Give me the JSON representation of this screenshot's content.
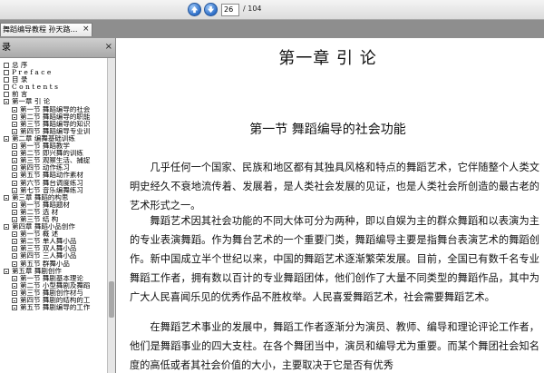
{
  "toolbar": {
    "page_current": "26",
    "page_total": "/ 104",
    "prev_icon": "arrow-up-icon",
    "next_icon": "arrow-down-icon"
  },
  "tab": {
    "title": "舞蹈编导教程 孙天路…",
    "close": "×"
  },
  "sidebar": {
    "header": "录",
    "close": "×",
    "items": [
      {
        "level": 1,
        "label": "总    序",
        "expand": false
      },
      {
        "level": 1,
        "label": "P r e f a c e",
        "expand": false
      },
      {
        "level": 1,
        "label": "目    录",
        "expand": false
      },
      {
        "level": 1,
        "label": "C o n t e n t s",
        "expand": false
      },
      {
        "level": 1,
        "label": "前    言",
        "expand": false
      },
      {
        "level": 1,
        "label": "第一章  引    论",
        "expand": true
      },
      {
        "level": 2,
        "label": "第一节   舞蹈编导的社会",
        "expand": false
      },
      {
        "level": 2,
        "label": "第二节   舞蹈编导的职能",
        "expand": false
      },
      {
        "level": 2,
        "label": "第三节   舞蹈编导的知识",
        "expand": false
      },
      {
        "level": 2,
        "label": "第四节   舞蹈编导专业训",
        "expand": false
      },
      {
        "level": 1,
        "label": "第二章  编舞基础训练",
        "expand": true
      },
      {
        "level": 2,
        "label": "第一节   舞蹈教学",
        "expand": false
      },
      {
        "level": 2,
        "label": "第二节   即兴舞的训练",
        "expand": false
      },
      {
        "level": 2,
        "label": "第三节   观察生活、捕捉",
        "expand": false
      },
      {
        "level": 2,
        "label": "第四节   动作练习",
        "expand": false
      },
      {
        "level": 2,
        "label": "第五节   舞蹈动作素材",
        "expand": false
      },
      {
        "level": 2,
        "label": "第六节   舞台调度练习",
        "expand": false
      },
      {
        "level": 2,
        "label": "第七节   音乐编舞练习",
        "expand": false
      },
      {
        "level": 1,
        "label": "第三章  舞蹈的构思",
        "expand": true
      },
      {
        "level": 2,
        "label": "第一节   舞蹈题材",
        "expand": false
      },
      {
        "level": 2,
        "label": "第二节   选      材",
        "expand": false
      },
      {
        "level": 2,
        "label": "第三节   结      构",
        "expand": false
      },
      {
        "level": 1,
        "label": "第四章  舞蹈小品创作",
        "expand": true
      },
      {
        "level": 2,
        "label": "第一节   概      述",
        "expand": false
      },
      {
        "level": 2,
        "label": "第二节   单人舞小品",
        "expand": false
      },
      {
        "level": 2,
        "label": "第三节   双人舞小品",
        "expand": false
      },
      {
        "level": 2,
        "label": "第四节   三人舞小品",
        "expand": false
      },
      {
        "level": 2,
        "label": "第五节   群舞小品",
        "expand": false
      },
      {
        "level": 1,
        "label": "第五章  舞剧创作",
        "expand": true
      },
      {
        "level": 2,
        "label": "第一节   舞剧基本理论",
        "expand": false
      },
      {
        "level": 2,
        "label": "第二节   小型舞剧及舞蹈",
        "expand": false
      },
      {
        "level": 2,
        "label": "第三节   舞剧创作材与",
        "expand": false
      },
      {
        "level": 2,
        "label": "第四节   舞剧的结构的工",
        "expand": false
      },
      {
        "level": 2,
        "label": "第五节   舞剧编导的工作",
        "expand": false
      }
    ]
  },
  "document": {
    "chapter_title": "第一章    引    论",
    "section_title": "第一节    舞蹈编导的社会功能",
    "paragraphs": [
      "几乎任何一个国家、民族和地区都有其独具风格和特点的舞蹈艺术，它伴随整个人类文明史经久不衰地流传着、发展着，是人类社会发展的见证，也是人类社会所创造的最古老的艺术形式之一。",
      "舞蹈艺术因其社会功能的不同大体可分为两种，即以自娱为主的群众舞蹈和以表演为主的专业表演舞蹈。作为舞台艺术的一个重要门类，舞蹈编导主要是指舞台表演艺术的舞蹈创作。新中国成立半个世纪以来，中国的舞蹈艺术逐渐繁荣发展。目前，全国已有数千名专业舞蹈工作者，拥有数以百计的专业舞蹈团体，他们创作了大量不同类型的舞蹈作品，其中为广大人民喜闻乐见的优秀作品不胜枚举。人民喜爱舞蹈艺术，社会需要舞蹈艺术。",
      "在舞蹈艺术事业的发展中，舞蹈工作者逐渐分为演员、教师、编导和理论评论工作者，他们是舞蹈事业的四大支柱。在各个舞团当中，演员和编导尤为重要。而某个舞团社会知名度的高低或者其社会价值的大小，主要取决于它是否有优秀"
    ]
  }
}
